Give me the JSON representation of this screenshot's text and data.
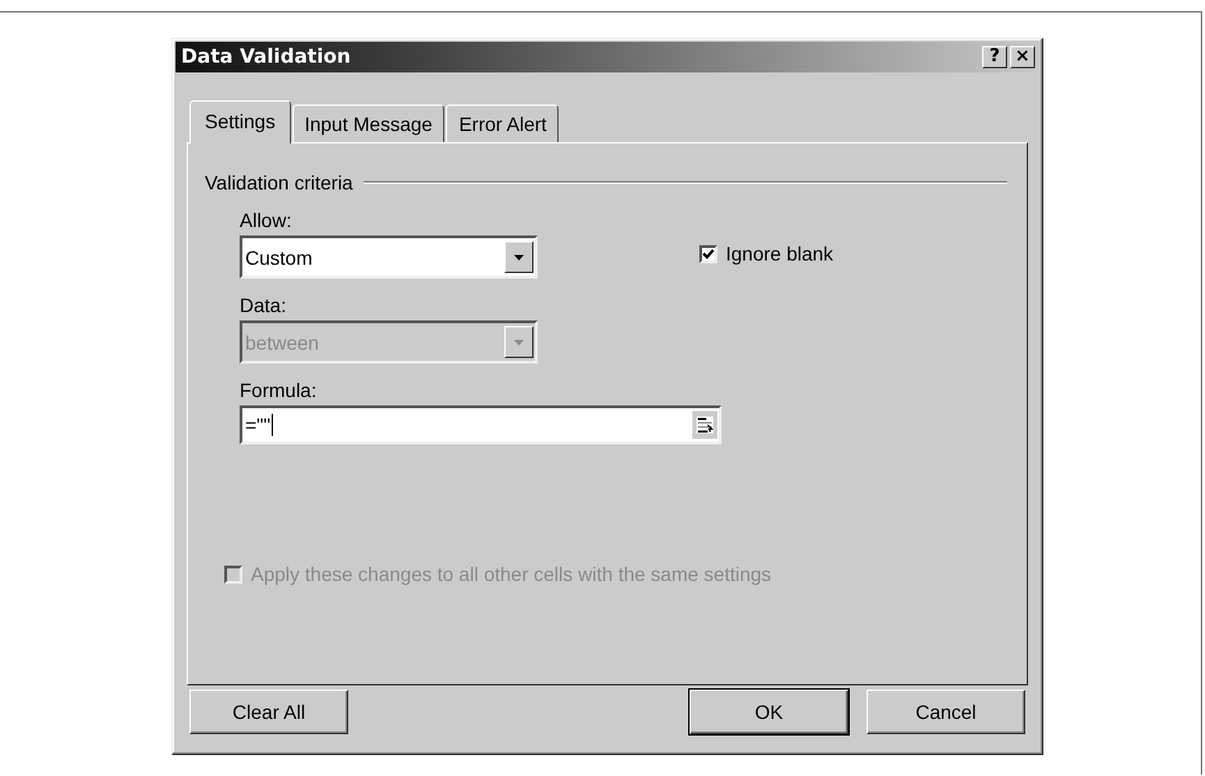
{
  "window": {
    "title": "Data Validation",
    "title_buttons": [
      "?",
      "×"
    ]
  },
  "tabs": [
    {
      "label": "Settings",
      "selected": true
    },
    {
      "label": "Input Message",
      "selected": false
    },
    {
      "label": "Error Alert",
      "selected": false
    }
  ],
  "settings": {
    "group_title": "Validation criteria",
    "allow": {
      "label": "Allow:",
      "value": "Custom",
      "disabled": false
    },
    "ignore_blank": {
      "label": "Ignore blank",
      "checked": true,
      "disabled": false
    },
    "data": {
      "label": "Data:",
      "value": "between",
      "disabled": true
    },
    "formula": {
      "label": "Formula:",
      "value": "=\"\""
    },
    "apply_all": {
      "label": "Apply these changes to all other cells with the same settings",
      "checked": false,
      "disabled": true
    }
  },
  "buttons": [
    {
      "label": "Clear All",
      "kind": "left",
      "default": false
    },
    {
      "label": "OK",
      "kind": "right",
      "default": true
    },
    {
      "label": "Cancel",
      "kind": "right",
      "default": false
    }
  ]
}
